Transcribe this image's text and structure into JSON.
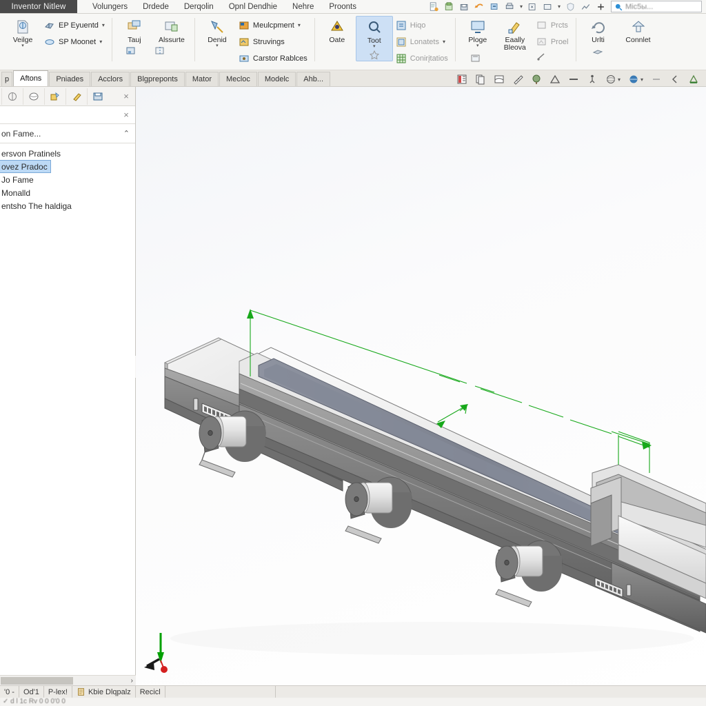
{
  "titlebar": {
    "document_tab": "Inventor Nitlew",
    "menus": [
      "Volungers",
      "Drdede",
      "Derqolin",
      "Opnl Dendhie",
      "Nehre",
      "Proonts"
    ],
    "quick_access_icons": [
      "new-icon",
      "open-icon",
      "save-icon",
      "undo-icon",
      "redo-icon",
      "print-icon",
      "select-icon",
      "measure-icon",
      "dropdown-icon",
      "shield-icon",
      "analyze-icon",
      "plus-icon"
    ],
    "search": {
      "placeholder": "Mic5ы...",
      "icon": "help-search-icon"
    }
  },
  "ribbon": {
    "groups": [
      {
        "name": "sketch-group",
        "big": [
          {
            "label": "Veilge",
            "icon": "sketch-icon",
            "has_caret": true,
            "selected": false
          }
        ],
        "small": [
          {
            "label": "EP Eyuentd",
            "icon": "extrude-icon",
            "caret": true,
            "dim": false
          },
          {
            "label": "SP Moonet",
            "icon": "revolve-icon",
            "caret": true,
            "dim": false
          }
        ]
      },
      {
        "name": "create-group",
        "big": [
          {
            "label": "Tauj",
            "icon": "place-component-icon",
            "has_caret": false,
            "selected": false
          },
          {
            "label": "Alssurte",
            "icon": "create-component-icon",
            "has_caret": false,
            "selected": false
          }
        ],
        "small": [
          {
            "label": "",
            "icon": "pattern-icon",
            "caret": false,
            "dim": false
          },
          {
            "label": "",
            "icon": "mirror-icon",
            "caret": false,
            "dim": false
          }
        ]
      },
      {
        "name": "position-group",
        "big": [
          {
            "label": "Denid",
            "icon": "constrain-icon",
            "has_caret": true,
            "selected": false
          }
        ],
        "small": [
          {
            "label": "Meulcpment",
            "icon": "move-icon",
            "caret": true,
            "dim": false
          },
          {
            "label": "Struvings",
            "icon": "rotate-icon",
            "caret": false,
            "dim": false
          },
          {
            "label": "Carstor Rablces",
            "icon": "show-icon",
            "caret": false,
            "dim": false
          }
        ]
      },
      {
        "name": "manage-group",
        "big": [
          {
            "label": "Oate",
            "icon": "hazard-icon",
            "has_caret": false,
            "selected": false
          },
          {
            "label": "Toot",
            "icon": "inspect-zoom-icon",
            "has_caret": true,
            "selected": true
          }
        ],
        "small": [
          {
            "label": "Hiqo",
            "icon": "parameters-icon",
            "caret": false,
            "dim": true
          },
          {
            "label": "Lonatets",
            "icon": "ipart-icon",
            "caret": true,
            "dim": true
          },
          {
            "label": "Conirįtatios",
            "icon": "spreadsheet-icon",
            "caret": false,
            "dim": true
          }
        ]
      },
      {
        "name": "view-group",
        "big": [
          {
            "label": "Ploge",
            "icon": "display-icon",
            "has_caret": true,
            "selected": false
          },
          {
            "label": "Eaally Bleova",
            "icon": "appearance-icon",
            "has_caret": false,
            "selected": false
          }
        ],
        "small": [
          {
            "label": "Prcts",
            "icon": "plane-icon",
            "caret": false,
            "dim": true
          },
          {
            "label": "Proel",
            "icon": "project-icon",
            "caret": false,
            "dim": true
          }
        ]
      },
      {
        "name": "tools-group",
        "big": [
          {
            "label": "Urlti",
            "icon": "update-icon",
            "has_caret": false,
            "selected": false
          },
          {
            "label": "Connlet",
            "icon": "convert-icon",
            "has_caret": false,
            "selected": false
          }
        ],
        "small": []
      }
    ],
    "star_icon": "favorite-icon",
    "extra_small_icons": [
      "flag-icon",
      "measure-small-icon",
      "hand-icon"
    ]
  },
  "ribbon_tabs": {
    "items": [
      "Aftons",
      "Pniades",
      "Acclors",
      "Blgpreponts",
      "Mator",
      "Mecloc",
      "Modelc",
      "Ahb..."
    ],
    "active_index": 0,
    "left_stub": "p"
  },
  "view_toolbar": {
    "icons": [
      "view-cube-icon",
      "copy-view-icon",
      "slice-icon",
      "measure-rule-icon",
      "environment-icon",
      "triad-icon",
      "minus-icon",
      "human-scale-icon",
      "orbit-icon",
      "appearance-globe-icon",
      "dash-icon",
      "back-icon",
      "ground-plane-icon"
    ]
  },
  "left_panel": {
    "toolbar_icons": [
      "filter-icon",
      "model-icon",
      "paint-icon",
      "highlight-icon",
      "save-view-icon"
    ],
    "close_label": "×",
    "row2_close_label": "×",
    "header": {
      "title": "on Fame...",
      "chevron": "⌃"
    },
    "tree": [
      {
        "label": "ersvon Pratinels",
        "selected": false
      },
      {
        "label": "ovez Pradoc",
        "selected": true
      },
      {
        "label": "Jo Fame",
        "selected": false
      },
      {
        "label": "Monalld",
        "selected": false
      },
      {
        "label": "entsho The haldiga",
        "selected": false
      }
    ],
    "scroll_arrow": "›"
  },
  "viewport": {
    "model_name": "linear-conveyor-assembly",
    "background_top": "#f3f5f8",
    "background_bottom": "#ffffff",
    "dimension_color": "#17a81a",
    "triad": {
      "x_color": "#1a1a1a",
      "y_color": "#00a000",
      "z_color": "#d42020"
    },
    "annotations": [
      {
        "name": "length-dimension",
        "type": "linear"
      },
      {
        "name": "width-dimension",
        "type": "linear"
      }
    ]
  },
  "statusbar": {
    "cells": [
      {
        "label": "'0 -",
        "icon": null
      },
      {
        "label": "Od'1",
        "icon": null
      },
      {
        "label": "P-lex!",
        "icon": null
      },
      {
        "label": "Kbie Dlqpalz",
        "icon": "doc-icon"
      },
      {
        "label": "Recicl",
        "icon": null
      },
      {
        "label": "",
        "icon": null
      }
    ],
    "bottom_hint": "✓  d l 1c  Rv  0 0 0'0 0"
  }
}
